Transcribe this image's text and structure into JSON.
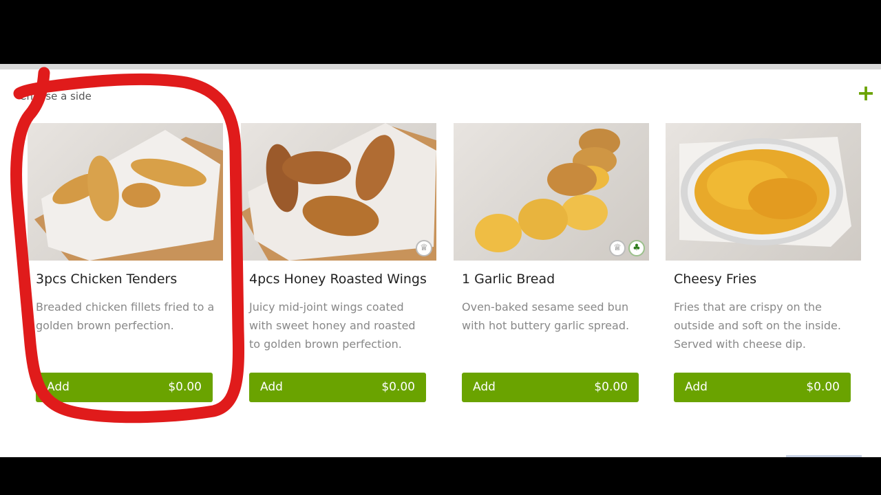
{
  "section": {
    "label": "Choose a side"
  },
  "cards": [
    {
      "title": "3pcs Chicken Tenders",
      "description": "Breaded chicken fillets fried to a golden brown perfection.",
      "add_label": "Add",
      "price": "$0.00",
      "icons": []
    },
    {
      "title": "4pcs Honey Roasted Wings",
      "description": "Juicy mid-joint wings coated with sweet honey and roasted to golden brown perfection.",
      "add_label": "Add",
      "price": "$0.00",
      "icons": [
        "chef-hat-icon"
      ]
    },
    {
      "title": "1 Garlic Bread",
      "description": "Oven-baked sesame seed bun with hot buttery garlic spread.",
      "add_label": "Add",
      "price": "$0.00",
      "icons": [
        "chef-hat-icon",
        "broccoli-icon"
      ]
    },
    {
      "title": "Cheesy Fries",
      "description": "Fries that are crispy on the outside and soft on the inside. Served with cheese dip.",
      "add_label": "Add",
      "price": "$0.00",
      "icons": []
    }
  ],
  "colors": {
    "accent": "#6aa300",
    "annotation": "#e01b1b"
  }
}
